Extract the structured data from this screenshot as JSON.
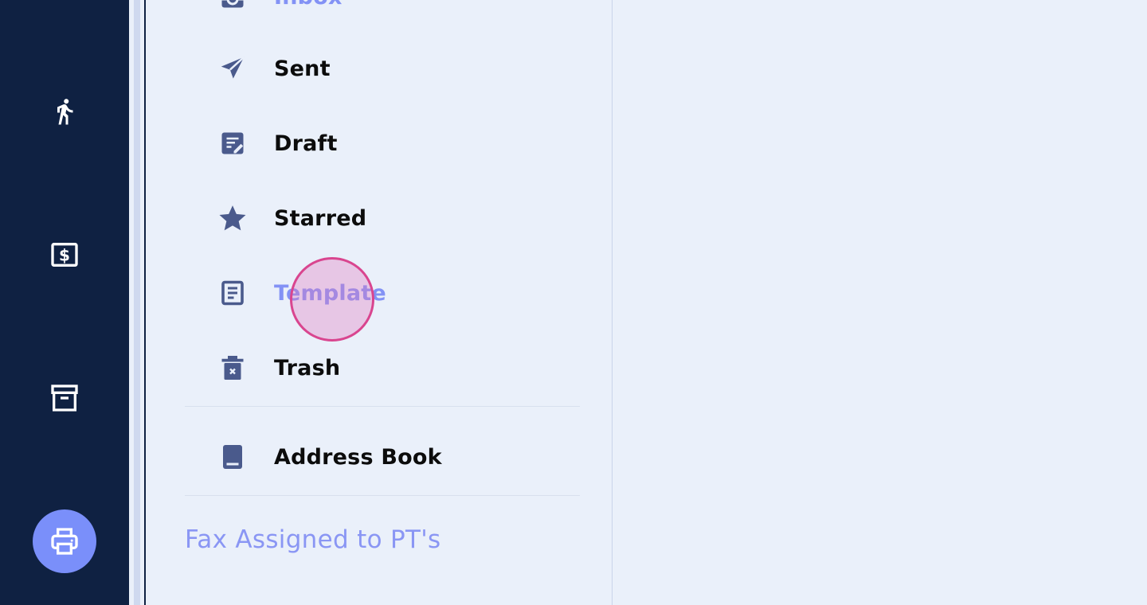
{
  "rail": {
    "items": [
      {
        "name": "walking-icon"
      },
      {
        "name": "billing-icon"
      },
      {
        "name": "archive-icon"
      },
      {
        "name": "printer-icon",
        "active": true
      }
    ]
  },
  "folders": {
    "items": [
      {
        "label": "Inbox",
        "icon": "inbox-icon"
      },
      {
        "label": "Sent",
        "icon": "send-icon"
      },
      {
        "label": "Draft",
        "icon": "draft-icon"
      },
      {
        "label": "Starred",
        "icon": "star-icon"
      },
      {
        "label": "Template",
        "icon": "template-icon",
        "active": true
      },
      {
        "label": "Trash",
        "icon": "trash-icon"
      },
      {
        "label": "Address Book",
        "icon": "book-icon"
      }
    ],
    "section_heading": "Fax Assigned to PT's"
  },
  "colors": {
    "rail_bg": "#0f2142",
    "panel_bg": "#eaf0fa",
    "icon": "#4a5a8c",
    "accent": "#7a8ffa",
    "active_text": "#8392f5"
  }
}
